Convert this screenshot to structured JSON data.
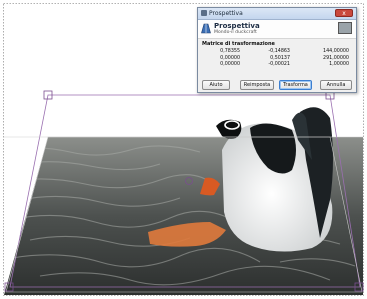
{
  "window": {
    "title": "Prospettiva",
    "close_label": "x"
  },
  "header": {
    "title": "Prospettiva",
    "subtitle": "Mondo-il duckcraft"
  },
  "matrix": {
    "label": "Matrice di trasformazione",
    "rows": [
      [
        "0,78355",
        "-0,14863",
        "144,00000"
      ],
      [
        "0,00000",
        "0,50137",
        "291,00000"
      ],
      [
        "0,00000",
        "-0,00021",
        "1,00000"
      ]
    ]
  },
  "buttons": {
    "help": "Aiuto",
    "reset": "Reimposta",
    "transform": "Trasforma",
    "cancel": "Annulla"
  },
  "colors": {
    "guide": "#9a6fb0",
    "handle": "#7a4e8f",
    "titlebar": "#c4d6ee"
  }
}
